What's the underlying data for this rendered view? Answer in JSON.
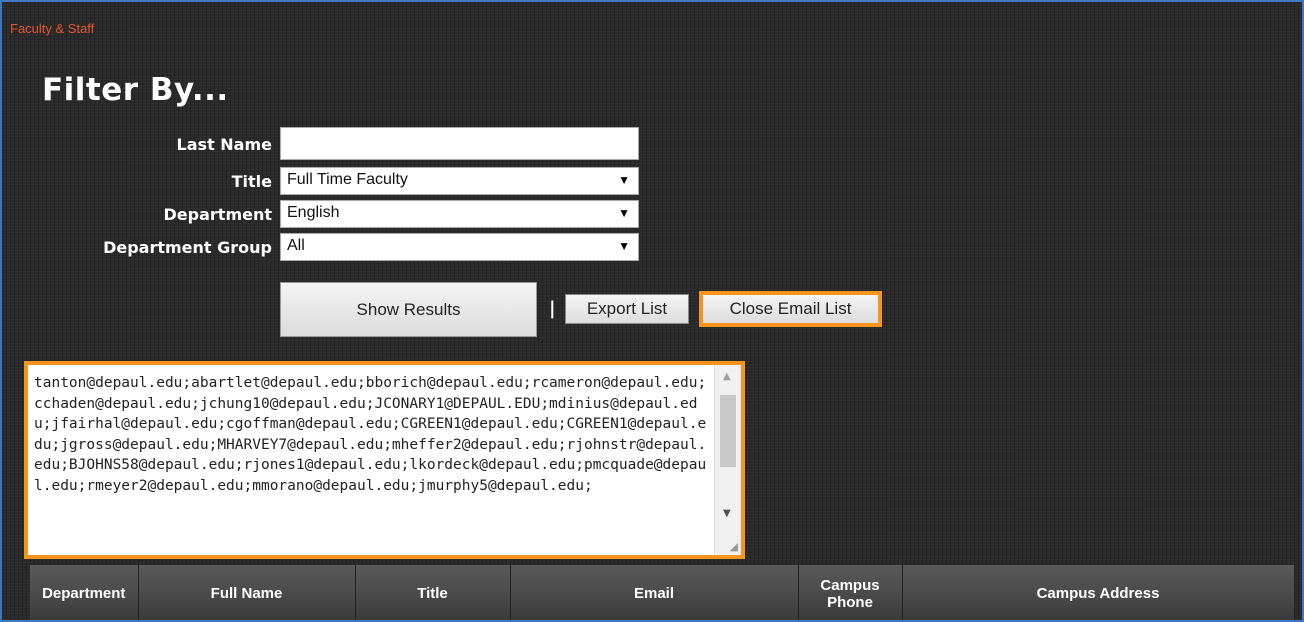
{
  "breadcrumb": "Faculty & Staff",
  "heading": "Filter By...",
  "filters": {
    "last_name": {
      "label": "Last Name",
      "value": ""
    },
    "title": {
      "label": "Title",
      "selected": "Full Time Faculty"
    },
    "department": {
      "label": "Department",
      "selected": "English"
    },
    "department_group": {
      "label": "Department Group",
      "selected": "All"
    }
  },
  "buttons": {
    "show_results": "Show Results",
    "separator": "|",
    "export_list": "Export List",
    "close_email_list": "Close Email List"
  },
  "email_list": "tanton@depaul.edu;abartlet@depaul.edu;bborich@depaul.edu;rcameron@depaul.edu;cchaden@depaul.edu;jchung10@depaul.edu;JCONARY1@DEPAUL.EDU;mdinius@depaul.edu;jfairhal@depaul.edu;cgoffman@depaul.edu;CGREEN1@depaul.edu;CGREEN1@depaul.edu;jgross@depaul.edu;MHARVEY7@depaul.edu;mheffer2@depaul.edu;rjohnstr@depaul.edu;BJOHNS58@depaul.edu;rjones1@depaul.edu;lkordeck@depaul.edu;pmcquade@depaul.edu;rmeyer2@depaul.edu;mmorano@depaul.edu;jmurphy5@depaul.edu;",
  "table": {
    "headers": [
      "Department",
      "Full Name",
      "Title",
      "Email",
      "Campus Phone",
      "Campus Address"
    ]
  },
  "colors": {
    "accent_orange": "#f7941d",
    "breadcrumb_red": "#e2572b",
    "background_dark": "#2a2a2a",
    "frame_blue": "#3d78c2"
  }
}
